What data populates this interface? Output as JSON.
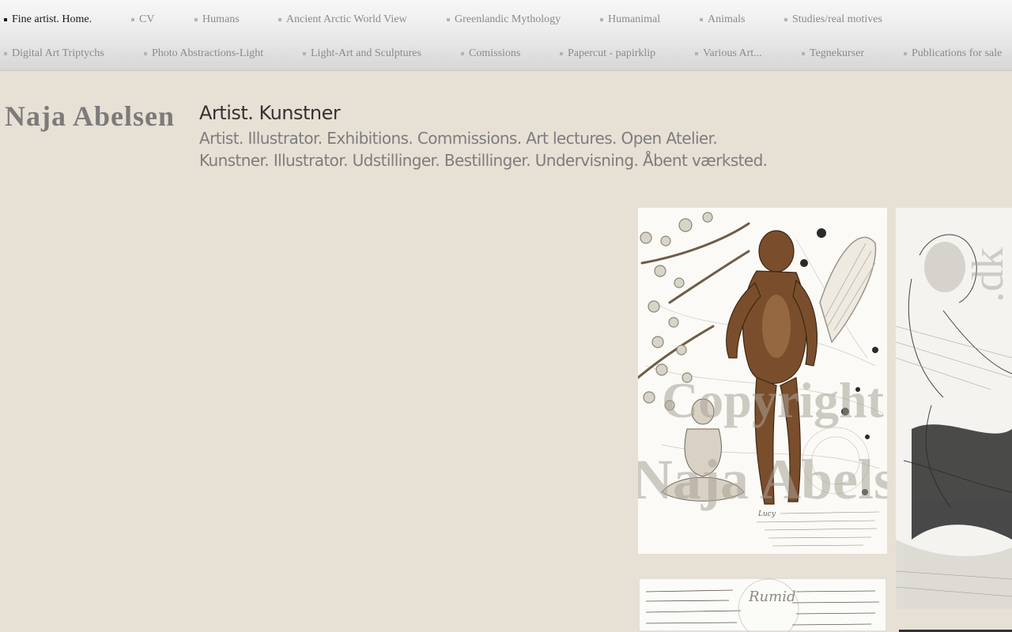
{
  "nav": {
    "row1": [
      {
        "label": "Fine artist. Home.",
        "active": true
      },
      {
        "label": "CV"
      },
      {
        "label": "Humans"
      },
      {
        "label": "Ancient Arctic World View"
      },
      {
        "label": "Greenlandic Mythology"
      },
      {
        "label": "Humanimal"
      },
      {
        "label": "Animals"
      },
      {
        "label": "Studies/real motives"
      }
    ],
    "row2": [
      {
        "label": "Digital Art Triptychs"
      },
      {
        "label": "Photo Abstractions-Light"
      },
      {
        "label": "Light-Art and Sculptures"
      },
      {
        "label": "Comissions"
      },
      {
        "label": "Papercut - papirklip"
      },
      {
        "label": "Various Art..."
      },
      {
        "label": "Tegnekurser"
      },
      {
        "label": "Publications for sale"
      }
    ]
  },
  "header": {
    "site_title": "Naja Abelsen",
    "headline": "Artist. Kunstner",
    "subline_en": "Artist. Illustrator. Exhibitions. Commissions. Art lectures. Open Atelier.",
    "subline_da": "Kunstner. Illustrator. Udstillinger. Bestillinger. Undervisning. Åbent værksted."
  },
  "artworks": {
    "watermark_1": "Copyright",
    "watermark_2": "Naja Abelsen",
    "watermark_3": ".dk",
    "caption_1": "Lucy",
    "caption_2": "Rumid"
  },
  "colors": {
    "page_background": "#e7e0d5",
    "nav_text": "#8a8a8a",
    "nav_active": "#1a1a1a",
    "title_grey": "#7b7b7b"
  }
}
